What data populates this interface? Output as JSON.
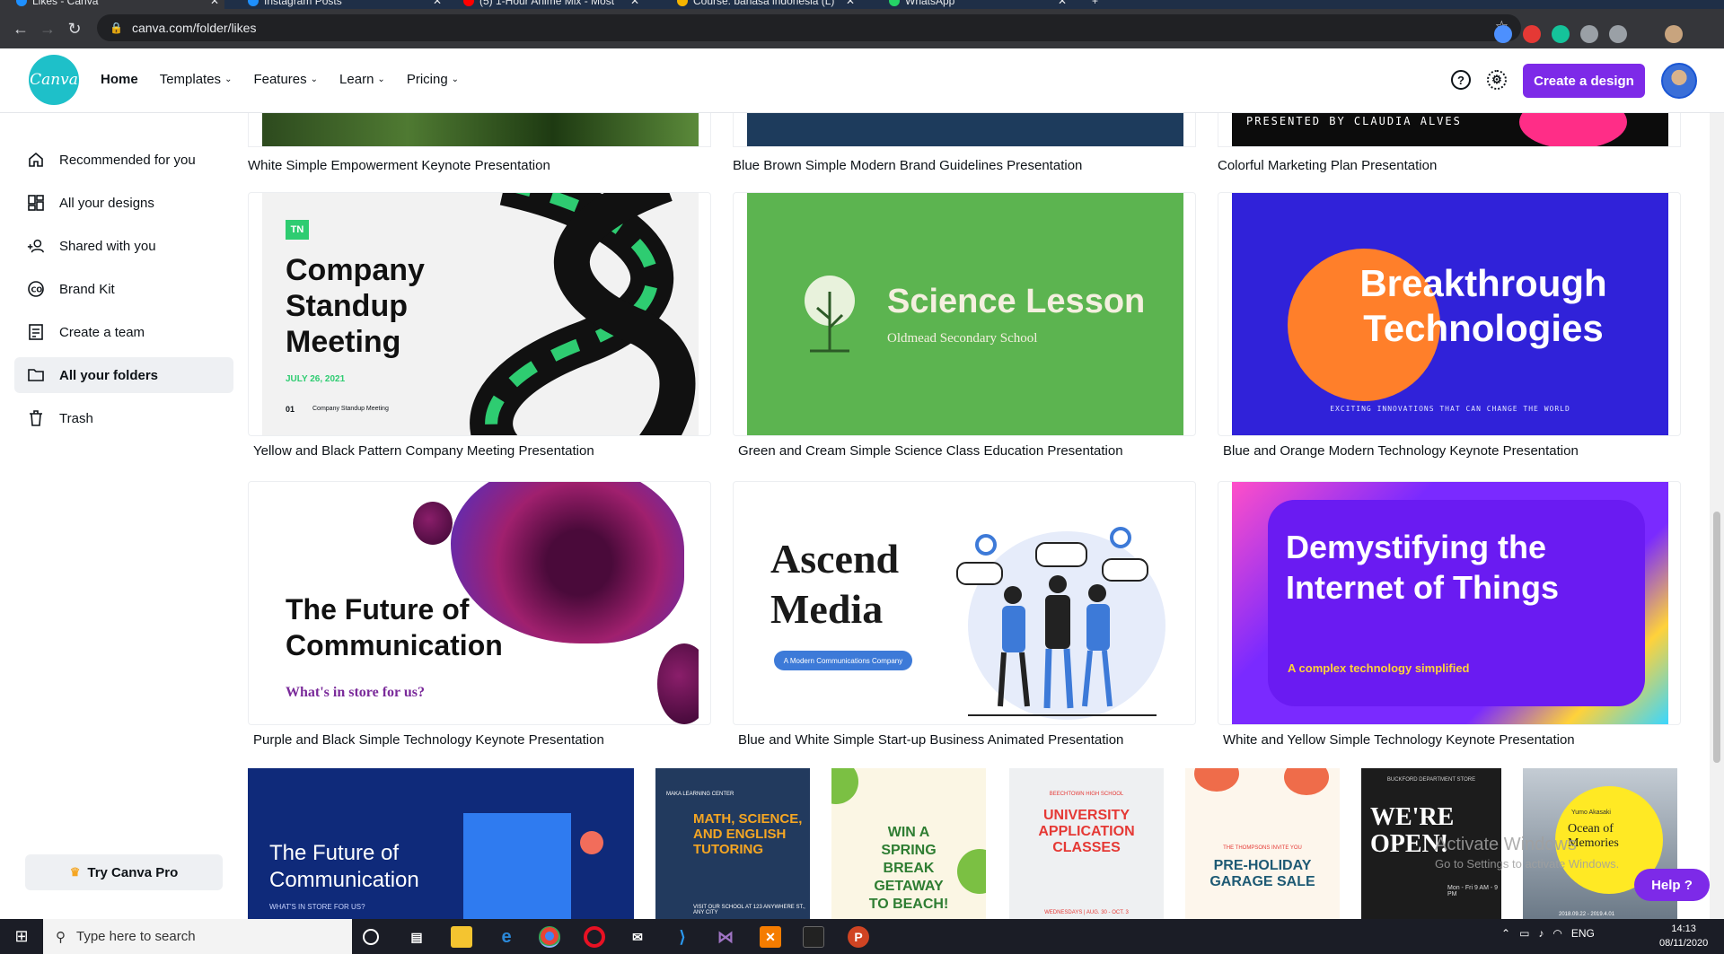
{
  "browser": {
    "tabs": [
      {
        "title": "Likes - Canva",
        "color": "#1e90ff"
      },
      {
        "title": "Instagram Posts",
        "color": "#1e90ff"
      },
      {
        "title": "(5) 1-Hour Anime Mix - Most",
        "color": "#ff0000"
      },
      {
        "title": "Course: bahasa indonesia (L)",
        "color": "#f5b400"
      },
      {
        "title": "WhatsApp",
        "color": "#25d366"
      }
    ],
    "url": "canva.com/folder/likes"
  },
  "header": {
    "logo_text": "Canva",
    "nav": [
      "Home",
      "Templates",
      "Features",
      "Learn",
      "Pricing"
    ],
    "help_icon": "?",
    "create_label": "Create a design",
    "accent": "#7d2ae8"
  },
  "sidebar": {
    "items": [
      {
        "label": "Recommended for you",
        "icon": "home-icon"
      },
      {
        "label": "All your designs",
        "icon": "grid-icon"
      },
      {
        "label": "Shared with you",
        "icon": "people-icon"
      },
      {
        "label": "Brand Kit",
        "icon": "brand-kit-icon"
      },
      {
        "label": "Create a team",
        "icon": "create-team-icon"
      },
      {
        "label": "All your folders",
        "icon": "folder-icon"
      },
      {
        "label": "Trash",
        "icon": "trash-icon"
      }
    ],
    "try_pro": "Try Canva Pro"
  },
  "top_row_titles": [
    "White Simple Empowerment Keynote Presentation",
    "Blue Brown Simple Modern Brand Guidelines Presentation",
    "Colorful Marketing Plan Presentation"
  ],
  "top_row_partial_text": "PRESENTED BY CLAUDIA ALVES",
  "cards": [
    {
      "title": "Yellow and Black Pattern Company Meeting Presentation",
      "badge": "TN",
      "heading": "Company Standup Meeting",
      "date": "JULY 26, 2021",
      "footer_num": "01",
      "footer_text": "Company Standup Meeting"
    },
    {
      "title": "Green and Cream Simple Science Class Education Presentation",
      "heading": "Science Lesson",
      "sub": "Oldmead Secondary School"
    },
    {
      "title": "Blue and Orange Modern Technology Keynote Presentation",
      "heading": "Breakthrough Technologies",
      "sub": "EXCITING INNOVATIONS THAT CAN CHANGE THE WORLD"
    },
    {
      "title": "Purple and Black Simple Technology Keynote Presentation",
      "heading": "The Future of Communication",
      "sub": "What's in store for us?"
    },
    {
      "title": "Blue and White Simple Start-up Business Animated Presentation",
      "heading": "Ascend Media",
      "sub": "A Modern Communications Company"
    },
    {
      "title": "White and Yellow Simple Technology Keynote Presentation",
      "heading": "Demystifying the Internet of Things",
      "sub": "A complex technology simplified"
    }
  ],
  "bottom_row": [
    {
      "heading": "The Future of Communication",
      "sub": "WHAT'S IN STORE FOR US?"
    },
    {
      "kicker": "MAKA LEARNING CENTER",
      "heading": "MATH, SCIENCE, AND ENGLISH TUTORING",
      "sub": "VISIT OUR SCHOOL AT 123 ANYWHERE ST., ANY CITY"
    },
    {
      "heading": "WIN A SPRING BREAK GETAWAY TO BEACH!"
    },
    {
      "kicker": "BEECHTOWN HIGH SCHOOL",
      "heading": "UNIVERSITY APPLICATION CLASSES",
      "sub": "WEDNESDAYS | AUG. 30 - OCT. 3"
    },
    {
      "kicker": "THE THOMPSONS INVITE YOU",
      "heading": "PRE-HOLIDAY GARAGE SALE"
    },
    {
      "kicker": "BUCKFORD DEPARTMENT STORE",
      "heading": "WE'RE OPEN!",
      "sub": "Mon - Fri 9 AM - 9 PM"
    },
    {
      "kicker": "Yumo Akasaki",
      "heading": "Ocean of Memories",
      "sub": "2018.09.22 - 2019.4.01"
    }
  ],
  "overlay": {
    "watermark_title": "Activate Windows",
    "watermark_sub": "Go to Settings to activate Windows.",
    "help_label": "Help ?"
  },
  "taskbar": {
    "search_placeholder": "Type here to search",
    "lang": "ENG",
    "time": "14:13",
    "date": "08/11/2020"
  }
}
